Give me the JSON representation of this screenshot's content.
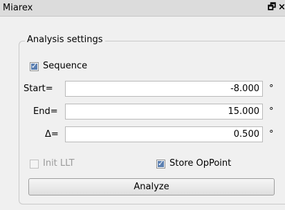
{
  "window": {
    "title": "Miarex",
    "float_icon": "🗗",
    "close_icon": "×"
  },
  "analysis": {
    "group_title": "Analysis settings",
    "sequence": {
      "label": "Sequence",
      "checked": true
    },
    "start": {
      "label": "Start=",
      "value": "-8.000",
      "unit": "°"
    },
    "end": {
      "label": "End=",
      "value": "15.000",
      "unit": "°"
    },
    "delta": {
      "label": "Δ=",
      "value": "0.500",
      "unit": "°"
    },
    "init_llt": {
      "label": "Init LLT",
      "checked": false,
      "enabled": false
    },
    "store_oppoint": {
      "label": "Store OpPoint",
      "checked": true
    },
    "analyze_label": "Analyze"
  }
}
